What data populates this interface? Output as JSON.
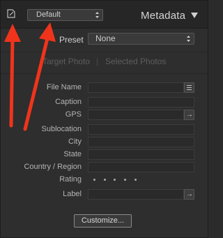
{
  "header": {
    "preset_value": "Default",
    "title": "Metadata"
  },
  "preset": {
    "label": "Preset",
    "value": "None"
  },
  "target": {
    "target_photo": "Target Photo",
    "separator": "|",
    "selected_photos": "Selected Photos"
  },
  "fields": [
    {
      "label": "File Name",
      "value": ""
    },
    {
      "label": "Caption",
      "value": ""
    },
    {
      "label": "GPS",
      "value": ""
    },
    {
      "label": "Sublocation",
      "value": ""
    },
    {
      "label": "City",
      "value": ""
    },
    {
      "label": "State",
      "value": ""
    },
    {
      "label": "Country / Region",
      "value": ""
    },
    {
      "label": "Rating",
      "value": ""
    },
    {
      "label": "Label",
      "value": ""
    }
  ],
  "rating": {
    "stars": 0,
    "max": 5
  },
  "customize_label": "Customize...",
  "icons": {
    "doc": "document-edit-icon",
    "updown": "stepper-updown-icon",
    "collapse": "collapse-triangle-icon",
    "list": "list-icon",
    "goto": "go-to-arrow-icon"
  },
  "colors": {
    "panel_bg": "#2e2e2e",
    "annotation_arrow": "#f0341c"
  }
}
